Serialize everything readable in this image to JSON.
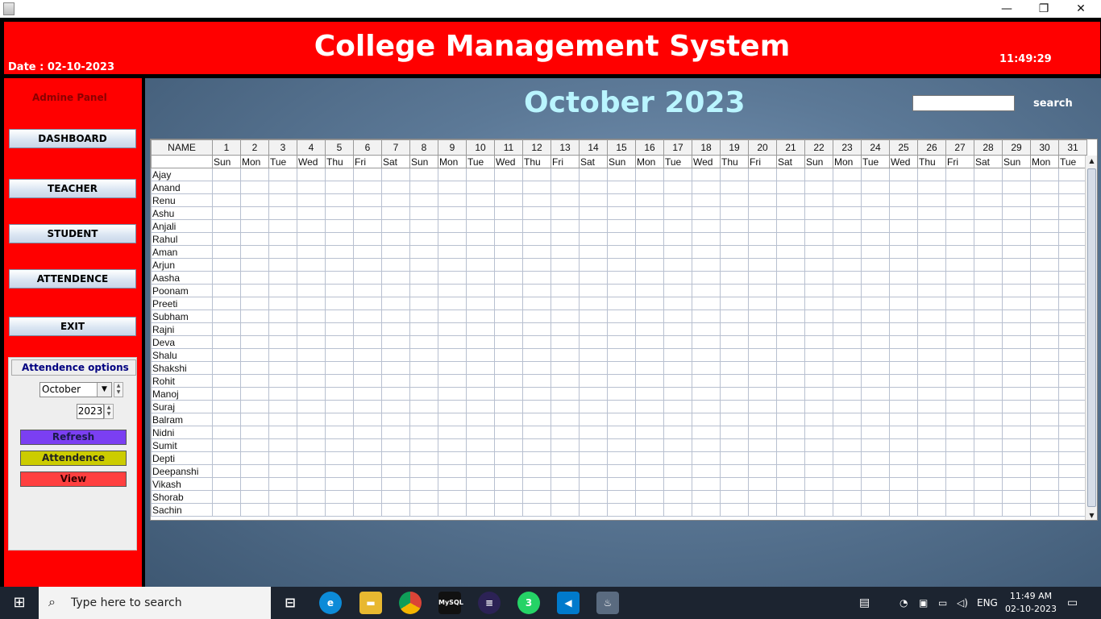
{
  "window": {
    "controls": [
      "—",
      "❐",
      "✕"
    ]
  },
  "header": {
    "title": "College Management System",
    "date_label": "Date :  02-10-2023",
    "time": "11:49:29"
  },
  "sidebar": {
    "panel_label": "Admine Panel",
    "nav": [
      "DASHBOARD",
      "TEACHER",
      "STUDENT",
      "ATTENDENCE",
      "EXIT"
    ],
    "attendance_options": {
      "tab_label": "Attendence options",
      "month": "October",
      "year": "2023",
      "refresh": "Refresh",
      "attendence": "Attendence",
      "view": "View"
    }
  },
  "main": {
    "calendar_title": "October  2023",
    "search_label": "search",
    "search_value": ""
  },
  "table": {
    "name_header": "NAME",
    "days": [
      "1",
      "2",
      "3",
      "4",
      "5",
      "6",
      "7",
      "8",
      "9",
      "10",
      "11",
      "12",
      "13",
      "14",
      "15",
      "16",
      "17",
      "18",
      "19",
      "20",
      "21",
      "22",
      "23",
      "24",
      "25",
      "26",
      "27",
      "28",
      "29",
      "30",
      "31"
    ],
    "weekdays": [
      "Sun",
      "Mon",
      "Tue",
      "Wed",
      "Thu",
      "Fri",
      "Sat",
      "Sun",
      "Mon",
      "Tue",
      "Wed",
      "Thu",
      "Fri",
      "Sat",
      "Sun",
      "Mon",
      "Tue",
      "Wed",
      "Thu",
      "Fri",
      "Sat",
      "Sun",
      "Mon",
      "Tue",
      "Wed",
      "Thu",
      "Fri",
      "Sat",
      "Sun",
      "Mon",
      "Tue"
    ],
    "students": [
      "Ajay",
      "Anand",
      "Renu",
      "Ashu",
      "Anjali",
      "Rahul",
      "Aman",
      "Arjun",
      "Aasha",
      "Poonam",
      "Preeti",
      "Subham",
      "Rajni",
      "Deva",
      "Shalu",
      "Shakshi",
      "Rohit",
      "Manoj",
      "Suraj",
      "Balram",
      "Nidni",
      "Sumit",
      "Depti",
      "Deepanshi",
      "Vikash",
      "Shorab",
      "Sachin"
    ]
  },
  "taskbar": {
    "search_placeholder": "Type here to search",
    "lang": "ENG",
    "clock_time": "11:49 AM",
    "clock_date": "02-10-2023",
    "whatsapp_badge": "3",
    "icons": [
      "windows-start-icon",
      "task-view-icon",
      "edge-icon",
      "file-explorer-icon",
      "chrome-icon",
      "mysql-icon",
      "eclipse-icon",
      "whatsapp-icon",
      "vscode-icon",
      "java-icon"
    ]
  },
  "colors": {
    "header_red": "#ff0000",
    "refresh_btn": "#7b3ff2",
    "attendence_btn": "#cccc00",
    "view_btn": "#ff4040",
    "calendar_title": "#b9f5ff"
  }
}
